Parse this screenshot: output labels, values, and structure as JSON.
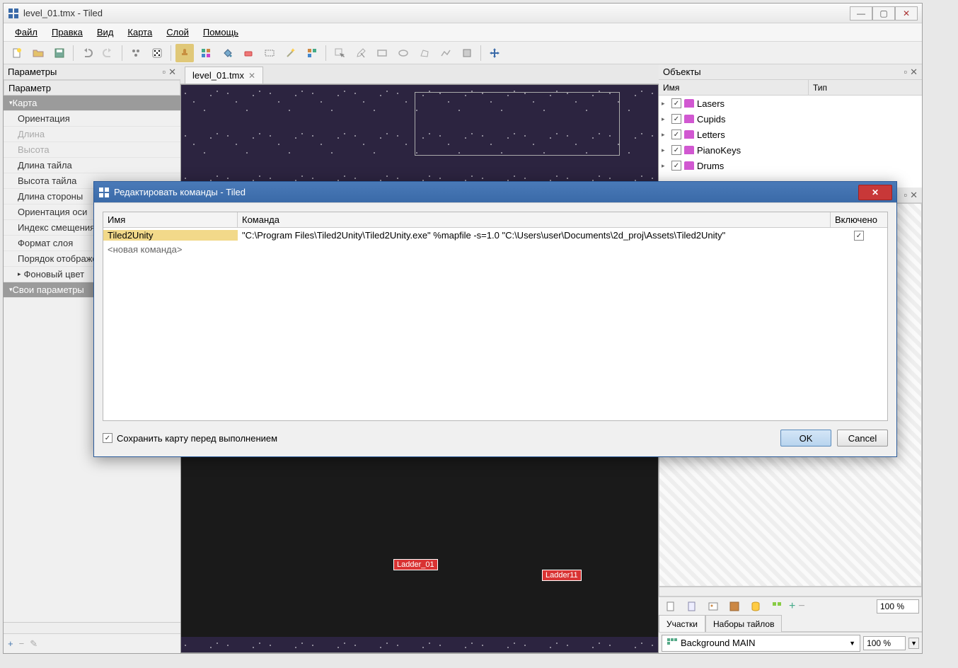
{
  "window": {
    "title": "level_01.tmx - Tiled"
  },
  "menu": {
    "file": "Файл",
    "edit": "Правка",
    "view": "Вид",
    "map": "Карта",
    "layer": "Слой",
    "help": "Помощь"
  },
  "panels": {
    "properties_title": "Параметры",
    "properties_col": "Параметр",
    "props": {
      "map": "Карта",
      "orientation": "Ориентация",
      "length": "Длина",
      "height": "Высота",
      "tile_length": "Длина тайла",
      "tile_height": "Высота тайла",
      "side_length": "Длина стороны",
      "orientation2": "Ориентация оси",
      "offset_index": "Индекс смещения",
      "layer_format": "Формат слоя",
      "render_order": "Порядок отображения",
      "bg_color": "Фоновый цвет",
      "custom": "Свои параметры"
    },
    "objects_title": "Объекты",
    "objects_col_name": "Имя",
    "objects_col_type": "Тип",
    "objects": [
      {
        "name": "Lasers",
        "checked": true
      },
      {
        "name": "Cupids",
        "checked": true
      },
      {
        "name": "Letters",
        "checked": true
      },
      {
        "name": "PianoKeys",
        "checked": true
      },
      {
        "name": "Drums",
        "checked": true
      }
    ],
    "patches": "Участки",
    "tilesets": "Наборы тайлов"
  },
  "tab": {
    "name": "level_01.tmx"
  },
  "labels": {
    "ladder1": "Ladder_01",
    "ladder11": "Ladder11"
  },
  "tileset": {
    "zoom": "100 %",
    "selected": "Background MAIN",
    "zoom2": "100 %"
  },
  "dialog": {
    "title": "Редактировать команды - Tiled",
    "col_name": "Имя",
    "col_cmd": "Команда",
    "col_enabled": "Включено",
    "cmd_name": "Tiled2Unity",
    "cmd_text": "\"C:\\Program Files\\Tiled2Unity\\Tiled2Unity.exe\" %mapfile -s=1.0 \"C:\\Users\\user\\Documents\\2d_proj\\Assets\\Tiled2Unity\"",
    "new_cmd": "<новая команда>",
    "save_before": "Сохранить карту перед выполнением",
    "ok": "OK",
    "cancel": "Cancel"
  }
}
